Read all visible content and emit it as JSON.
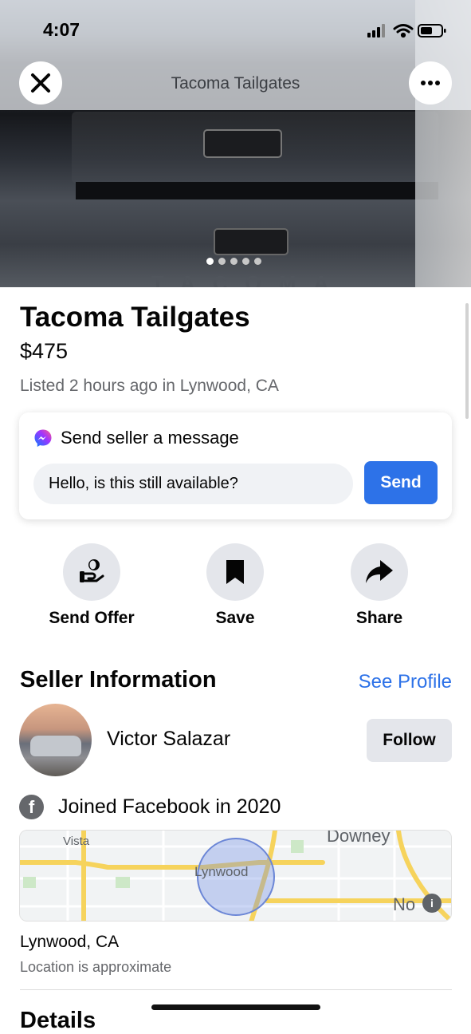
{
  "status_bar": {
    "time": "4:07"
  },
  "top_bar": {
    "title": "Tacoma Tailgates"
  },
  "gallery": {
    "count": 5,
    "active_index": 0,
    "photo_text": "TACOMA"
  },
  "listing": {
    "title": "Tacoma Tailgates",
    "price": "$475",
    "meta": "Listed 2 hours ago in Lynwood, CA"
  },
  "message_card": {
    "heading": "Send seller a message",
    "input_value": "Hello, is this still available?",
    "send_label": "Send"
  },
  "actions": [
    {
      "label": "Send Offer",
      "icon": "hand-coin-icon"
    },
    {
      "label": "Save",
      "icon": "bookmark-icon"
    },
    {
      "label": "Share",
      "icon": "share-arrow-icon"
    }
  ],
  "seller": {
    "heading": "Seller Information",
    "see_profile": "See Profile",
    "name": "Victor Salazar",
    "follow_label": "Follow",
    "joined": "Joined Facebook in 2020"
  },
  "map": {
    "labels": [
      "Vista",
      "Lynwood",
      "Downey",
      "Norwalk"
    ],
    "center_label": "Lynwood"
  },
  "location": {
    "name": "Lynwood, CA",
    "note": "Location is approximate"
  },
  "details_heading": "Details",
  "colors": {
    "accent": "#2d72e8",
    "muted": "#65676b",
    "button_bg": "#e4e6eb"
  }
}
